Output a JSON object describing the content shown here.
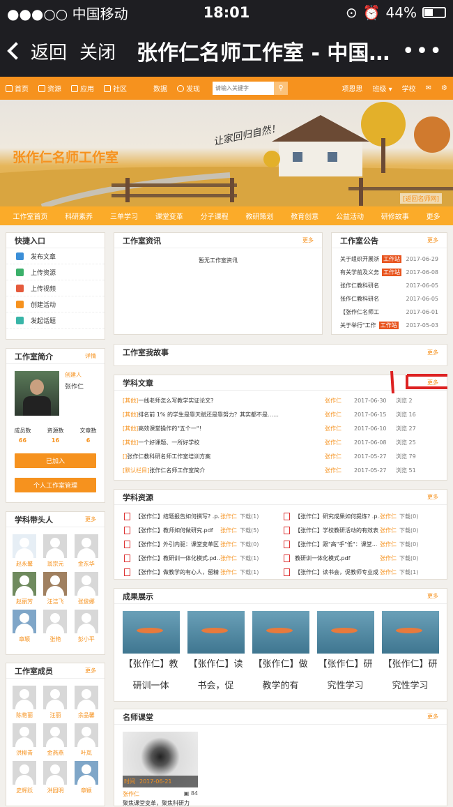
{
  "status": {
    "carrier": "●●●○○ 中国移动",
    "time": "18:01",
    "battery": "44%"
  },
  "nav": {
    "back": "返回",
    "close": "关闭",
    "title": "张作仁名师工作室 - 中国…",
    "more": "•••"
  },
  "topnav": {
    "items": [
      "首页",
      "资源",
      "应用",
      "社区"
    ],
    "data": "数据",
    "discover": "发现",
    "search_placeholder": "请输入关键字",
    "user": "项恩思",
    "class": "班级",
    "school": "学校"
  },
  "banner": {
    "name": "张作仁名师工作室",
    "slogan": "让家回归自然！",
    "return": "[返回名师网]"
  },
  "tabs": [
    "工作室首页",
    "科研素养",
    "三单学习",
    "课堂变革",
    "分子课程",
    "教研策划",
    "教育创意",
    "公益活动",
    "研修故事",
    "更多"
  ],
  "quick": {
    "title": "快捷入口",
    "items": [
      "发布文章",
      "上传资源",
      "上传视频",
      "创建活动",
      "发起话题"
    ]
  },
  "news": {
    "title": "工作室资讯",
    "more": "更多",
    "empty": "暂无工作室资讯"
  },
  "notice": {
    "title": "工作室公告",
    "more": "更多",
    "items": [
      {
        "text": "关于组织开展浙",
        "tag": "工作站",
        "date": "2017-06-29"
      },
      {
        "text": "有关学前及义务",
        "tag": "工作站",
        "date": "2017-06-08"
      },
      {
        "text": "张作仁教科研名",
        "tag": "",
        "date": "2017-06-05"
      },
      {
        "text": "张作仁教科研名",
        "tag": "",
        "date": "2017-06-05"
      },
      {
        "text": "【张作仁名师工",
        "tag": "",
        "date": "2017-06-01"
      },
      {
        "text": "关于举行\"工作",
        "tag": "工作站",
        "date": "2017-05-03"
      }
    ]
  },
  "intro": {
    "title": "工作室简介",
    "more": "详情",
    "role": "创建人",
    "name": "张作仁",
    "stats": [
      {
        "label": "成员数",
        "value": "66"
      },
      {
        "label": "资源数",
        "value": "16"
      },
      {
        "label": "文章数",
        "value": "6"
      }
    ],
    "joined": "已加入",
    "manage": "个人工作室管理"
  },
  "story": {
    "title": "工作室我故事",
    "more": "更多"
  },
  "articles": {
    "title": "学科文章",
    "more": "更多",
    "items": [
      {
        "cat": "[其他]",
        "title": "一线老师怎么写教学实证论文?",
        "author": "张作仁",
        "date": "2017-06-30",
        "views": "浏览 2"
      },
      {
        "cat": "[其他]",
        "title": "排名前 1% 的学生是靠天赋还是靠努力？其实都不是……",
        "author": "张作仁",
        "date": "2017-06-15",
        "views": "浏览 16"
      },
      {
        "cat": "[其他]",
        "title": "高效课堂操作的\"五个一\"！",
        "author": "张作仁",
        "date": "2017-06-10",
        "views": "浏览 27"
      },
      {
        "cat": "[其他]",
        "title": "一个好课题、一所好学校",
        "author": "张作仁",
        "date": "2017-06-08",
        "views": "浏览 25"
      },
      {
        "cat": "[]",
        "title": "张作仁教科研名师工作室培训方案",
        "author": "张作仁",
        "date": "2017-05-27",
        "views": "浏览 79"
      },
      {
        "cat": "[默认栏目]",
        "title": "张作仁名师工作室简介",
        "author": "张作仁",
        "date": "2017-05-27",
        "views": "浏览 51"
      }
    ]
  },
  "resources": {
    "title": "学科资源",
    "more": "更多",
    "left": [
      {
        "t": "【张作仁】结题报告如何撰写? .p...",
        "a": "张作仁",
        "d": "下载(1)"
      },
      {
        "t": "【张作仁】教师如何做研究.pdf",
        "a": "张作仁",
        "d": "下载(5)"
      },
      {
        "t": "【张作仁】外引内驱：课堂变革区",
        "a": "张作仁",
        "d": "下载(0)"
      },
      {
        "t": "【张作仁】教研训一体化模式.pd...",
        "a": "张作仁",
        "d": "下载(1)"
      },
      {
        "t": "【张作仁】做教学的有心人，留精",
        "a": "张作仁",
        "d": "下载(1)"
      }
    ],
    "right": [
      {
        "t": "【张作仁】研究成果如何提炼? .p...",
        "a": "张作仁",
        "d": "下载(0)"
      },
      {
        "t": "【张作仁】学校教研活动的有效表",
        "a": "张作仁",
        "d": "下载(0)"
      },
      {
        "t": "【张作仁】跟\"高\"手\"低\"：课堂...",
        "a": "张作仁",
        "d": "下载(0)"
      },
      {
        "t": "教研训一体化模式.pdf",
        "a": "张作仁",
        "d": "下载(0)"
      },
      {
        "t": "【张作仁】读书会，促教师专业成",
        "a": "张作仁",
        "d": "下载(1)"
      }
    ]
  },
  "achieve": {
    "title": "成果展示",
    "more": "更多",
    "items": [
      {
        "l1": "【张作仁】教",
        "l2": "研训一体"
      },
      {
        "l1": "【张作仁】读",
        "l2": "书会，促"
      },
      {
        "l1": "【张作仁】做",
        "l2": "教学的有"
      },
      {
        "l1": "【张作仁】研",
        "l2": "究性学习"
      },
      {
        "l1": "【张作仁】研",
        "l2": "究性学习"
      }
    ]
  },
  "leaders": {
    "title": "学科带头人",
    "more": "更多",
    "members": [
      "赵永馨",
      "翁宗元",
      "金东华",
      "赵丽芳",
      "汪洁飞",
      "张俊娜",
      "章颖",
      "张艳",
      "彭小平"
    ]
  },
  "members": {
    "title": "工作室成员",
    "more": "更多",
    "members": [
      "陈艳丽",
      "汪丽",
      "余品馨",
      "洪柳青",
      "金燕燕",
      "叶岚",
      "史辉跃",
      "洪园明",
      "章颖"
    ]
  },
  "course": {
    "title": "名师课堂",
    "more": "更多",
    "time": "时间",
    "date": "2017-06-21",
    "author": "张作仁",
    "views": "84",
    "caption": "聚焦课堂变革，聚焦科研力"
  }
}
